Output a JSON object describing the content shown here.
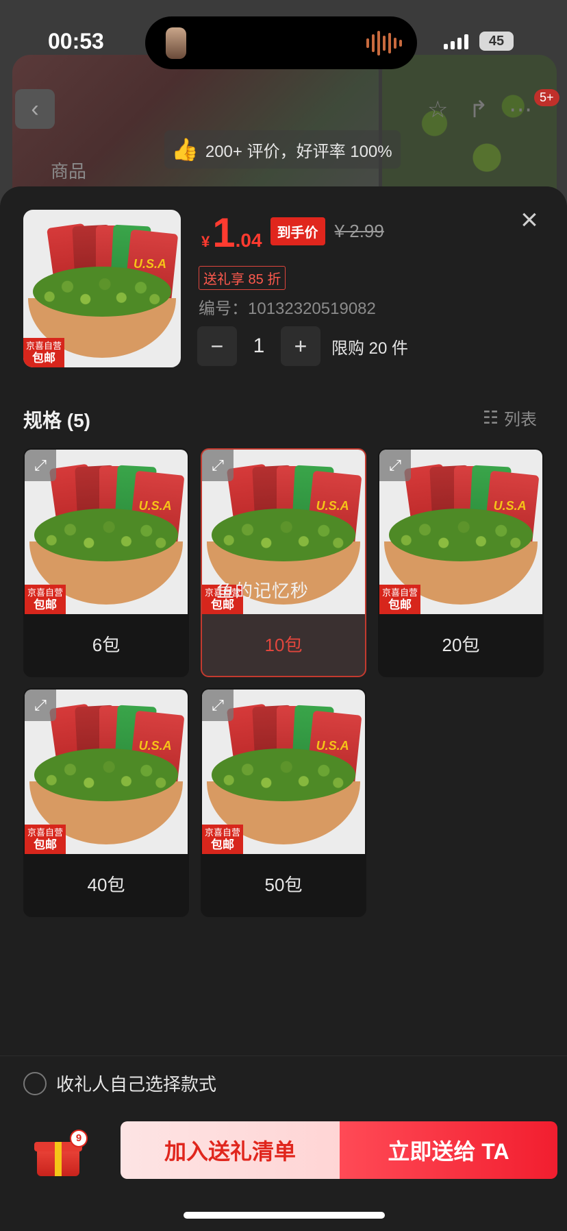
{
  "status_bar": {
    "time": "00:53",
    "battery": "45"
  },
  "background": {
    "tab_goods": "商品",
    "review_summary": "200+ 评价，好评率 100%",
    "notification_badge": "5+"
  },
  "product": {
    "price_symbol": "¥",
    "price_int": "1",
    "price_dec": ".04",
    "price_tag": "到手价",
    "original_price": "¥ 2.99",
    "coupon": "送礼享 85 折",
    "code_label": "编号：10132320519082",
    "quantity": "1",
    "limit": "限购 20 件",
    "jd_tag_top": "京喜自营",
    "jd_tag_bottom": "包邮",
    "bag_text": "U.S.A"
  },
  "specs": {
    "title": "规格 (5)",
    "view_toggle": "列表",
    "items": [
      {
        "label": "6包",
        "selected": false
      },
      {
        "label": "10包",
        "selected": true
      },
      {
        "label": "20包",
        "selected": false
      },
      {
        "label": "40包",
        "selected": false
      },
      {
        "label": "50包",
        "selected": false
      }
    ],
    "watermark": "鱼的记忆秒"
  },
  "receiver_option": "收礼人自己选择款式",
  "bottom": {
    "gift_count": "9",
    "add_button": "加入送礼清单",
    "send_button": "立即送给 TA"
  },
  "colors": {
    "accent": "#e0261d",
    "sheet_bg": "#1f1f1f"
  }
}
